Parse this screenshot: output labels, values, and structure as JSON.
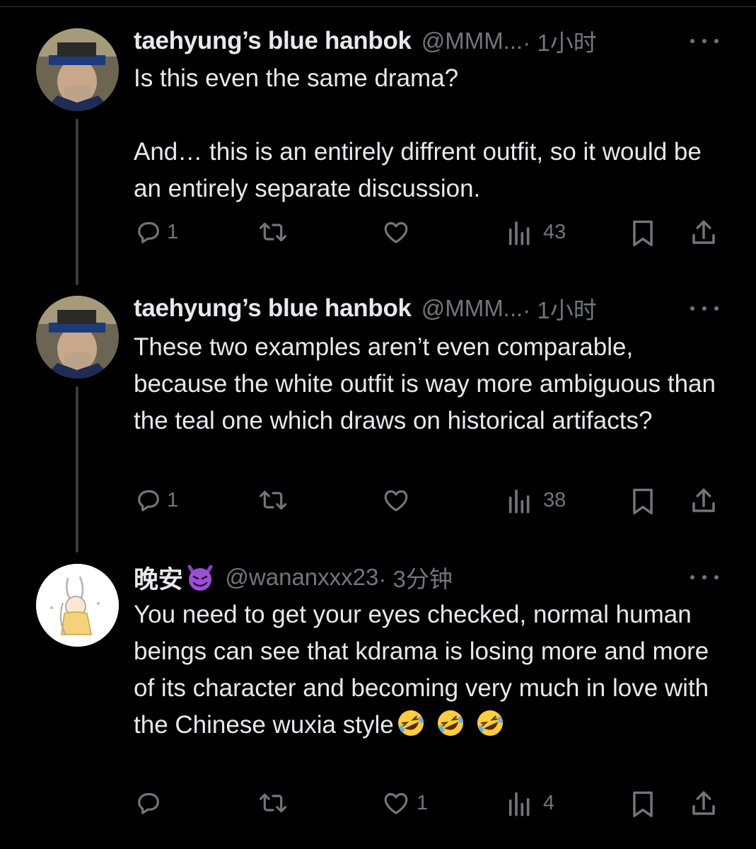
{
  "tweets": [
    {
      "name": "taehyung’s blue hanbok",
      "handle": "@MMM...",
      "time": "· 1小时",
      "text": "Is this even the same drama?\n\nAnd… this is an entirely diffrent outfit, so it would be an entirely separate discussion.",
      "replies": "1",
      "retweets": "",
      "likes": "",
      "views": "43"
    },
    {
      "name": "taehyung’s blue hanbok",
      "handle": "@MMM...",
      "time": "· 1小时",
      "text": "These two examples aren’t even comparable, because the white outfit is way more ambiguous than the teal one which draws on historical artifacts?",
      "replies": "1",
      "retweets": "",
      "likes": "",
      "views": "38"
    },
    {
      "name": "晚安",
      "name_emoji": "smiling-imp-emoji",
      "handle": "@wananxxx23",
      "time": "· 3分钟",
      "text": "You need to get your eyes checked, normal human beings can see that kdrama is losing more and more of its character and becoming very much in love with the Chinese wuxia style",
      "text_emojis": [
        "rofl-emoji",
        "rofl-emoji",
        "rofl-emoji"
      ],
      "replies": "",
      "retweets": "",
      "likes": "1",
      "views": "4"
    }
  ],
  "colors": {
    "background": "#000000",
    "text": "#e7e9ea",
    "muted": "#71767b",
    "thread_line": "#3a3d40"
  },
  "icons": [
    "reply-icon",
    "retweet-icon",
    "like-icon",
    "views-icon",
    "bookmark-icon",
    "share-icon",
    "more-icon"
  ]
}
